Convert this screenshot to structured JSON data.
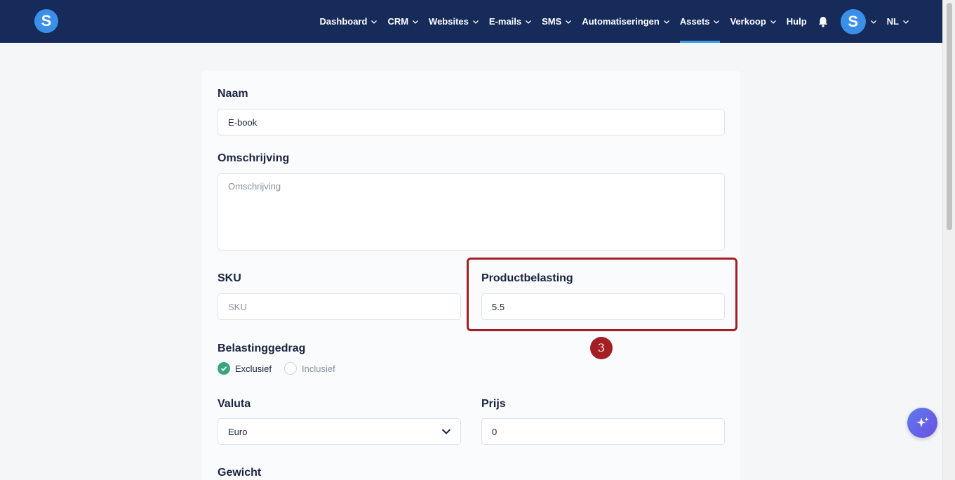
{
  "brand": {
    "logo_letter": "S"
  },
  "nav": {
    "items": [
      {
        "label": "Dashboard",
        "has_dropdown": true
      },
      {
        "label": "CRM",
        "has_dropdown": true
      },
      {
        "label": "Websites",
        "has_dropdown": true
      },
      {
        "label": "E-mails",
        "has_dropdown": true
      },
      {
        "label": "SMS",
        "has_dropdown": true
      },
      {
        "label": "Automatiseringen",
        "has_dropdown": true
      },
      {
        "label": "Assets",
        "has_dropdown": true,
        "active": true
      },
      {
        "label": "Verkoop",
        "has_dropdown": true
      },
      {
        "label": "Hulp",
        "has_dropdown": false
      }
    ],
    "avatar_letter": "S",
    "language": "NL"
  },
  "form": {
    "naam": {
      "label": "Naam",
      "value": "E-book"
    },
    "omschrijving": {
      "label": "Omschrijving",
      "placeholder": "Omschrijving"
    },
    "sku": {
      "label": "SKU",
      "placeholder": "SKU"
    },
    "productbelasting": {
      "label": "Productbelasting",
      "value": "5.5"
    },
    "belastinggedrag": {
      "label": "Belastinggedrag",
      "options": [
        {
          "label": "Exclusief",
          "checked": true
        },
        {
          "label": "Inclusief",
          "checked": false
        }
      ]
    },
    "valuta": {
      "label": "Valuta",
      "selected": "Euro"
    },
    "prijs": {
      "label": "Prijs",
      "value": "0"
    },
    "gewicht": {
      "label": "Gewicht"
    }
  },
  "annotation": {
    "step_number": "3"
  },
  "colors": {
    "topbar": "#172b5a",
    "accent_blue": "#3a8fe8",
    "highlight_red": "#a31f24",
    "radio_green": "#3aa57a"
  }
}
